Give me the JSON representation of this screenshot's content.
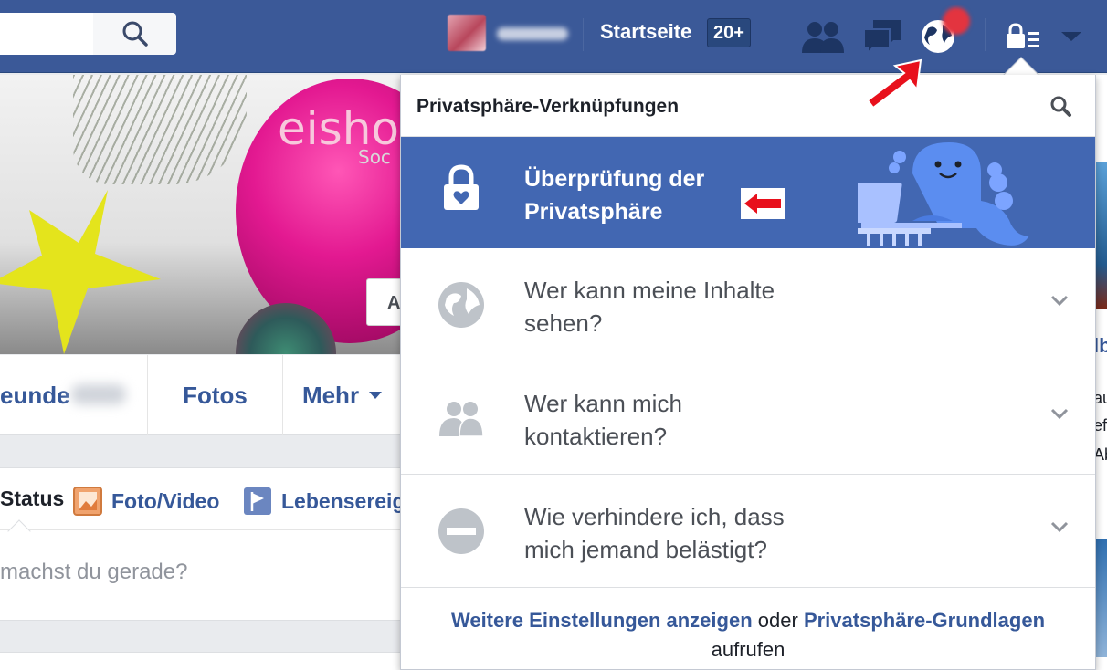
{
  "topbar": {
    "home_label": "Startseite",
    "home_badge": "20+"
  },
  "profile": {
    "cover_text": "eisho",
    "cover_subtext": "Soc",
    "cover_button_label": "A",
    "tabs": [
      {
        "label": "eunde"
      },
      {
        "label": "Fotos"
      },
      {
        "label": "Mehr"
      }
    ],
    "composer": {
      "status_label": "Status",
      "photo_label": "Foto/Video",
      "event_label": "Lebensereig",
      "placeholder": "machst du gerade?"
    }
  },
  "right_column": {
    "snippets": [
      "lb",
      "au",
      "ef",
      "Ab"
    ]
  },
  "privacy_panel": {
    "title": "Privatsphäre-Verknüpfungen",
    "highlight": {
      "line1": "Überprüfung der",
      "line2": "Privatsphäre"
    },
    "items": [
      {
        "line1": "Wer kann meine Inhalte",
        "line2": "sehen?",
        "icon": "globe-icon"
      },
      {
        "line1": "Wer kann mich",
        "line2": "kontaktieren?",
        "icon": "people-icon"
      },
      {
        "line1": "Wie verhindere ich, dass",
        "line2": "mich jemand belästigt?",
        "icon": "block-icon"
      }
    ],
    "footer": {
      "link1": "Weitere Einstellungen anzeigen",
      "connector": "oder",
      "link2": "Privatsphäre-Grundlagen",
      "suffix": "aufrufen"
    }
  },
  "colors": {
    "facebook_blue": "#3b5998",
    "highlight_blue": "#4267b2",
    "link_blue": "#365899",
    "annotation_red": "#e8101c"
  }
}
